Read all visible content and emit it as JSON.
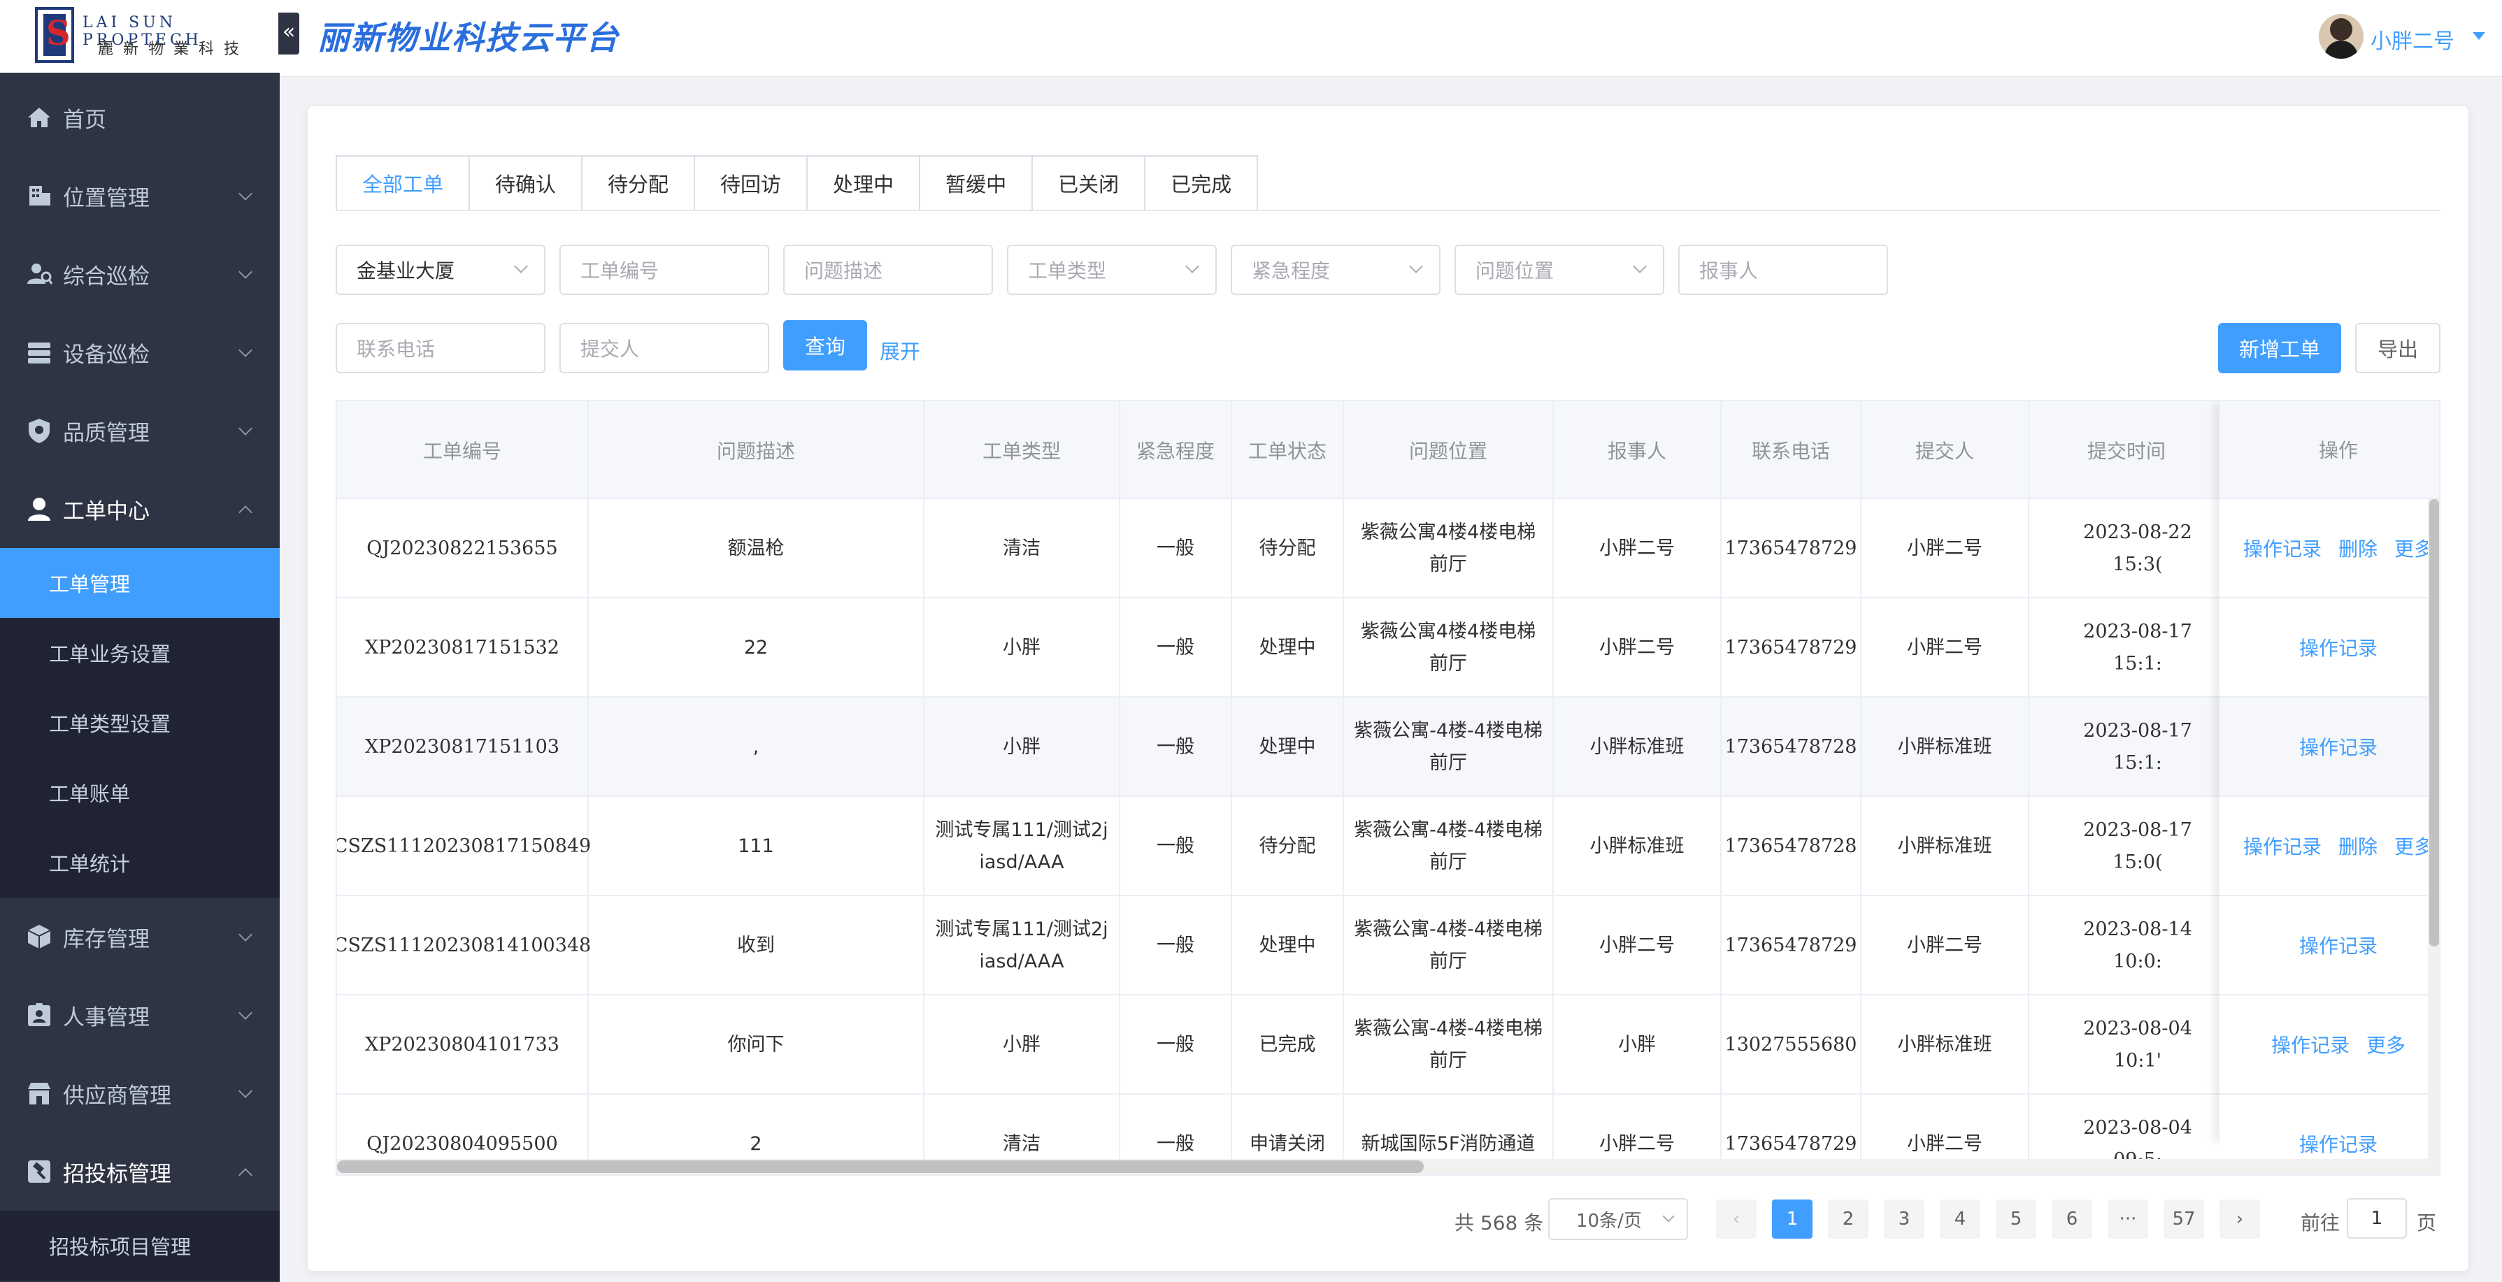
{
  "logo": {
    "en": "LAI SUN PROPTECH",
    "cn": "麗新物業科技"
  },
  "header": {
    "title": "丽新物业科技云平台",
    "user_name": "小胖二号"
  },
  "sidebar": {
    "items": [
      {
        "label": "首页",
        "icon": "home-icon"
      },
      {
        "label": "位置管理",
        "icon": "building-icon"
      },
      {
        "label": "综合巡检",
        "icon": "inspection-icon"
      },
      {
        "label": "设备巡检",
        "icon": "device-icon"
      },
      {
        "label": "品质管理",
        "icon": "shield-icon"
      },
      {
        "label": "工单中心",
        "icon": "user-icon"
      },
      {
        "label": "库存管理",
        "icon": "box-icon"
      },
      {
        "label": "人事管理",
        "icon": "id-card-icon"
      },
      {
        "label": "供应商管理",
        "icon": "store-icon"
      },
      {
        "label": "招投标管理",
        "icon": "gavel-icon"
      }
    ],
    "workorder_sub": [
      "工单管理",
      "工单业务设置",
      "工单类型设置",
      "工单账单",
      "工单统计"
    ],
    "bidding_sub": [
      "招投标项目管理"
    ]
  },
  "tabs": [
    "全部工单",
    "待确认",
    "待分配",
    "待回访",
    "处理中",
    "暂缓中",
    "已关闭",
    "已完成"
  ],
  "filters": {
    "building": "金基业大厦",
    "order_no": "工单编号",
    "description": "问题描述",
    "type": "工单类型",
    "urgency": "紧急程度",
    "location": "问题位置",
    "reporter": "报事人",
    "phone": "联系电话",
    "submitter": "提交人"
  },
  "buttons": {
    "query": "查询",
    "expand": "展开",
    "add": "新增工单",
    "export": "导出"
  },
  "table": {
    "headers": [
      "工单编号",
      "问题描述",
      "工单类型",
      "紧急程度",
      "工单状态",
      "问题位置",
      "报事人",
      "联系电话",
      "提交人",
      "提交时间",
      "操作"
    ],
    "rows": [
      {
        "no": "QJ20230822153655",
        "desc": "额温枪",
        "type": "清洁",
        "urgency": "一般",
        "status": "待分配",
        "location": "紫薇公寓4楼4楼电梯前厅",
        "reporter": "小胖二号",
        "phone": "17365478729",
        "submitter": "小胖二号",
        "time": "2023-08-22 15:3(",
        "ops": [
          "操作记录",
          "删除",
          "更多"
        ]
      },
      {
        "no": "XP20230817151532",
        "desc": "22",
        "type": "小胖",
        "urgency": "一般",
        "status": "处理中",
        "location": "紫薇公寓4楼4楼电梯前厅",
        "reporter": "小胖二号",
        "phone": "17365478729",
        "submitter": "小胖二号",
        "time": "2023-08-17 15:1:",
        "ops": [
          "操作记录"
        ]
      },
      {
        "no": "XP20230817151103",
        "desc": ",",
        "type": "小胖",
        "urgency": "一般",
        "status": "处理中",
        "location": "紫薇公寓-4楼-4楼电梯前厅",
        "reporter": "小胖标准班",
        "phone": "17365478728",
        "submitter": "小胖标准班",
        "time": "2023-08-17 15:1:",
        "ops": [
          "操作记录"
        ]
      },
      {
        "no": "CSZS11120230817150849",
        "desc": "111",
        "type": "测试专属111/测试2jiasd/AAA",
        "urgency": "一般",
        "status": "待分配",
        "location": "紫薇公寓-4楼-4楼电梯前厅",
        "reporter": "小胖标准班",
        "phone": "17365478728",
        "submitter": "小胖标准班",
        "time": "2023-08-17 15:0(",
        "ops": [
          "操作记录",
          "删除",
          "更多"
        ]
      },
      {
        "no": "CSZS11120230814100348",
        "desc": "收到",
        "type": "测试专属111/测试2jiasd/AAA",
        "urgency": "一般",
        "status": "处理中",
        "location": "紫薇公寓-4楼-4楼电梯前厅",
        "reporter": "小胖二号",
        "phone": "17365478729",
        "submitter": "小胖二号",
        "time": "2023-08-14 10:0:",
        "ops": [
          "操作记录"
        ]
      },
      {
        "no": "XP20230804101733",
        "desc": "你问下",
        "type": "小胖",
        "urgency": "一般",
        "status": "已完成",
        "location": "紫薇公寓-4楼-4楼电梯前厅",
        "reporter": "小胖",
        "phone": "13027555680",
        "submitter": "小胖标准班",
        "time": "2023-08-04 10:1'",
        "ops": [
          "操作记录",
          "更多"
        ]
      },
      {
        "no": "QJ20230804095500",
        "desc": "2",
        "type": "清洁",
        "urgency": "一般",
        "status": "申请关闭",
        "location": "新城国际5F消防通道",
        "reporter": "小胖二号",
        "phone": "17365478729",
        "submitter": "小胖二号",
        "time": "2023-08-04 09:5:",
        "ops": [
          "操作记录"
        ]
      }
    ]
  },
  "pagination": {
    "total": "共 568 条",
    "page_size": "10条/页",
    "pages": [
      "1",
      "2",
      "3",
      "4",
      "5",
      "6",
      "···",
      "57"
    ],
    "current": "1",
    "goto_prefix": "前往",
    "goto_value": "1",
    "goto_suffix": "页"
  },
  "colors": {
    "primary": "#409eff",
    "sidebar_bg": "#2e3443",
    "submenu_bg": "#1f2333",
    "title": "#2a6ede"
  }
}
